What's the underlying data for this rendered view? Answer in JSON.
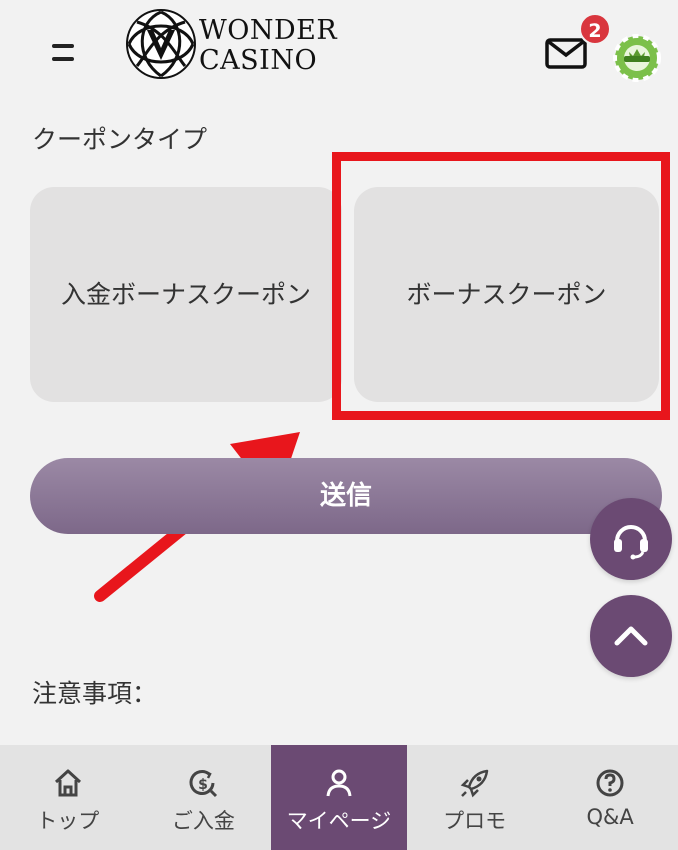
{
  "header": {
    "logo_line1": "WONDER",
    "logo_line2": "CASINO",
    "mail_badge_count": "2"
  },
  "coupon_section": {
    "label": "クーポンタイプ",
    "options": [
      {
        "label": "入金ボーナスクーポン"
      },
      {
        "label": "ボーナスクーポン"
      }
    ]
  },
  "submit_label": "送信",
  "notes_label": "注意事項：",
  "bottom_nav": {
    "items": [
      {
        "label": "トップ",
        "icon": "home-icon"
      },
      {
        "label": "ご入金",
        "icon": "deposit-icon"
      },
      {
        "label": "マイページ",
        "icon": "user-icon",
        "active": true
      },
      {
        "label": "プロモ",
        "icon": "rocket-icon"
      },
      {
        "label": "Q&A",
        "icon": "question-icon"
      }
    ]
  },
  "colors": {
    "accent_purple": "#6b4a73",
    "submit_gradient_top": "#9b89a5",
    "highlight_red": "#e8161c",
    "badge_red": "#d9363e",
    "card_gray": "#e2e1e1"
  }
}
